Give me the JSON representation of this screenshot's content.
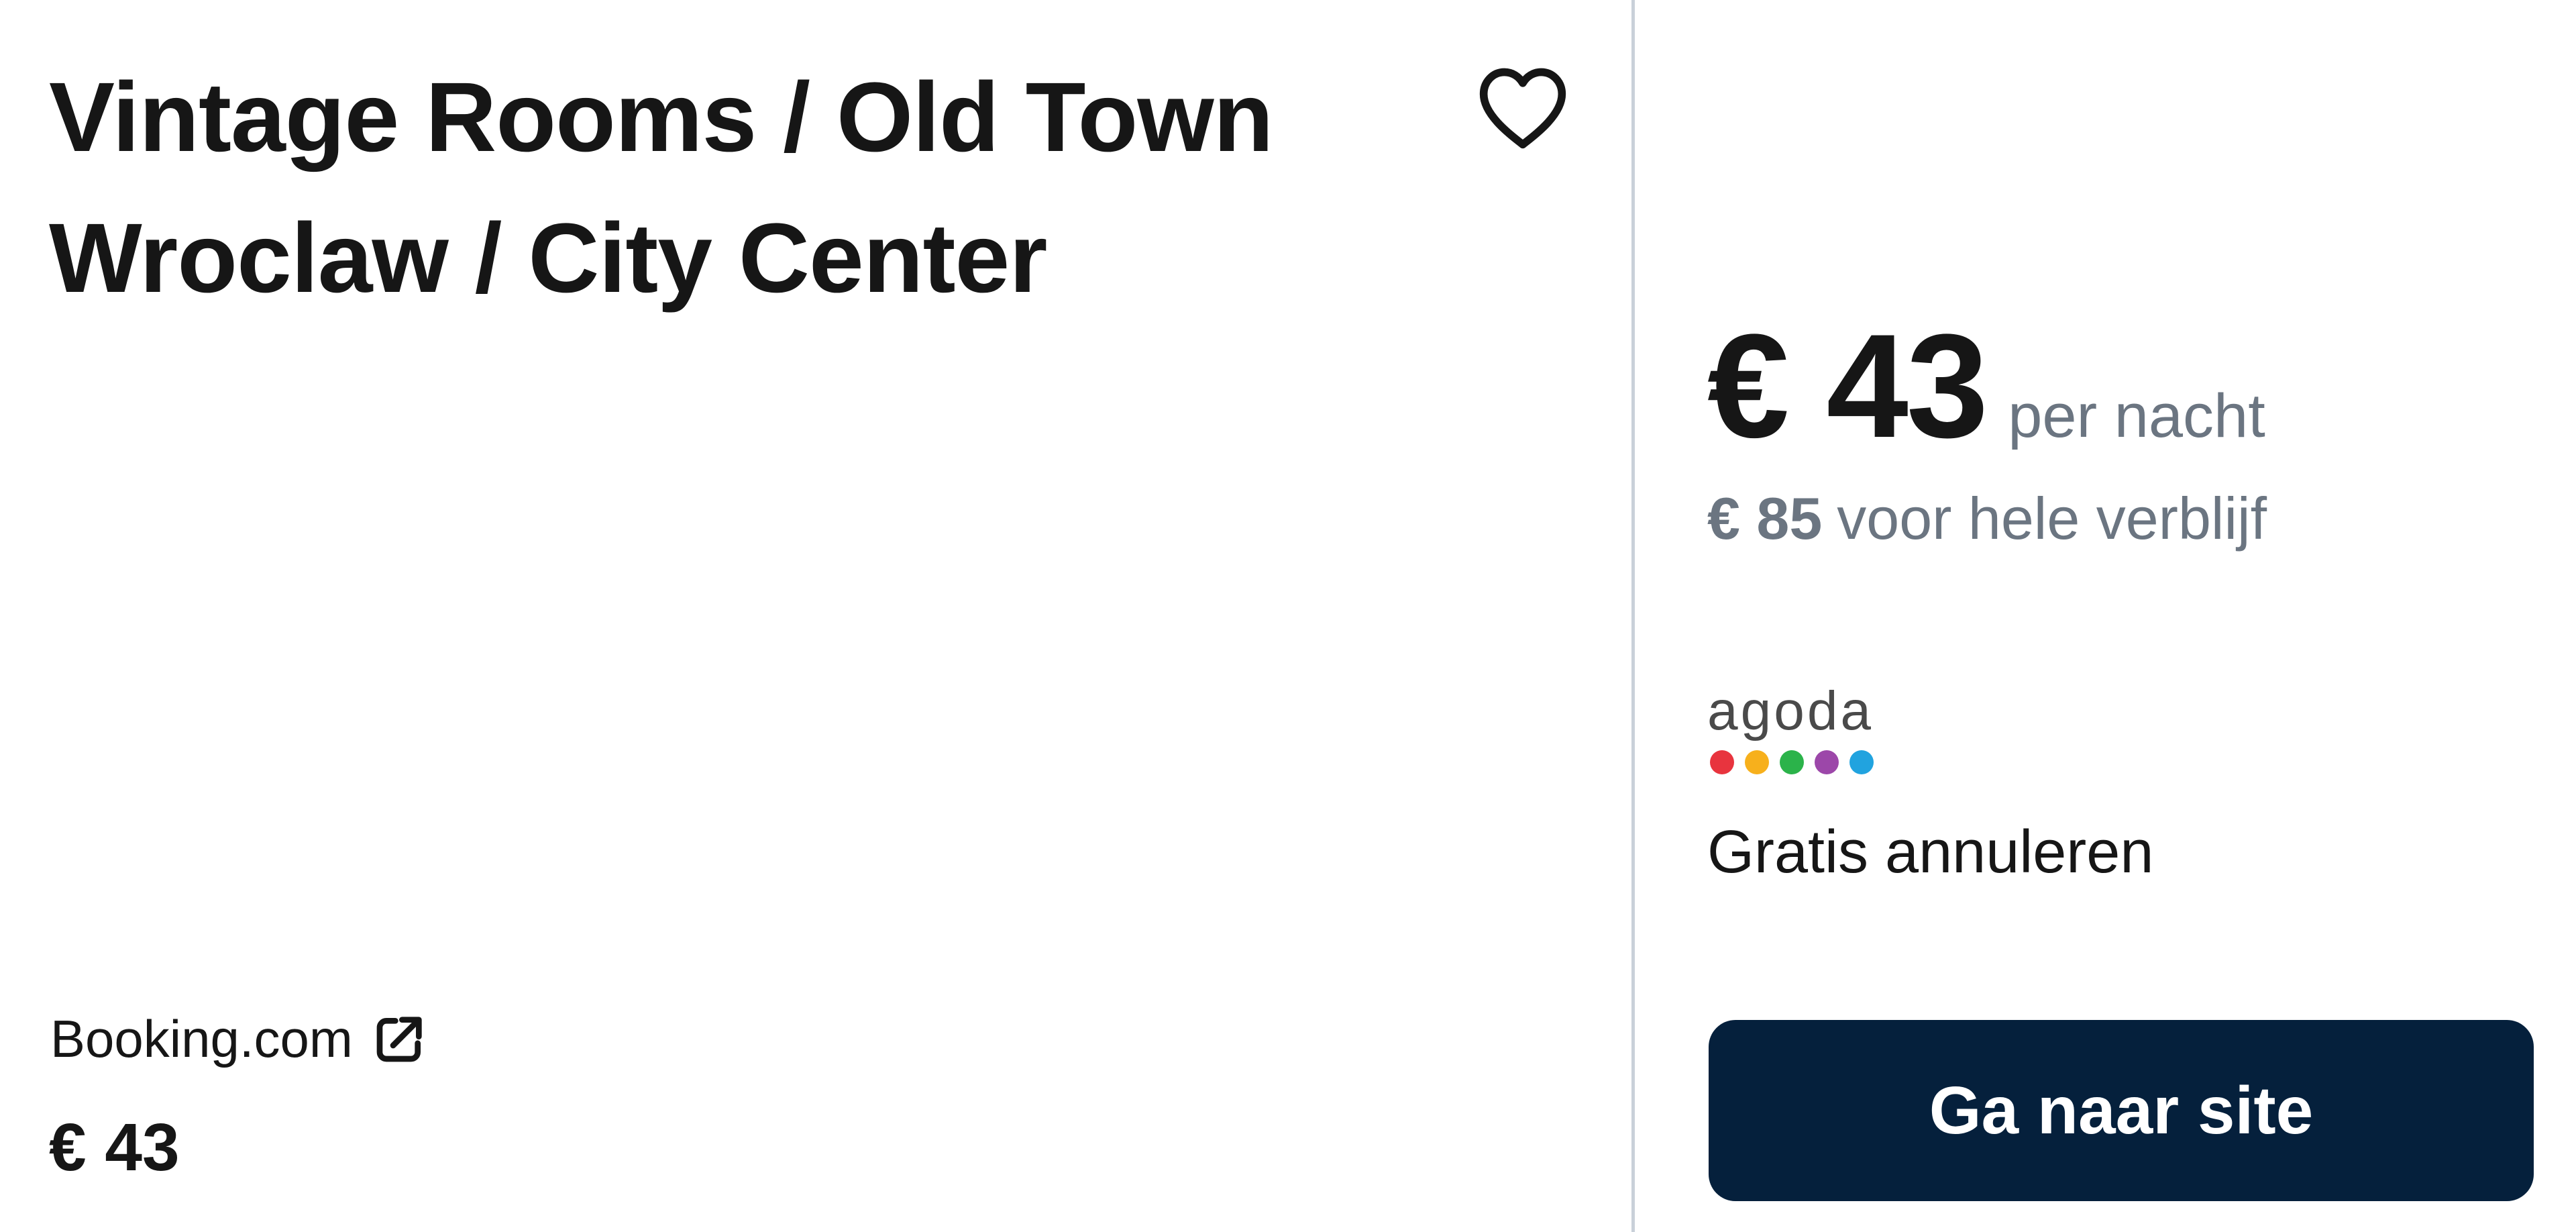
{
  "hotel": {
    "title_line1": "Vintage Rooms / Old Town",
    "title_line2": "Wroclaw / City Center"
  },
  "favorite": {
    "icon": "heart-outline-icon"
  },
  "left_offer": {
    "provider": "Booking.com",
    "provider_icon": "external-link-icon",
    "price": "€ 43"
  },
  "right_offer": {
    "nightly_price": "€ 43",
    "per_night_label": "per nacht",
    "total_price": "€ 85",
    "total_label": "voor hele verblijf",
    "provider_logo": {
      "text": "agoda",
      "dot_colors": [
        "#e8343e",
        "#f7b01c",
        "#2bb34a",
        "#9c47a9",
        "#21a3df"
      ]
    },
    "cancellation": "Gratis annuleren",
    "cta_label": "Ga naar site"
  },
  "colors": {
    "text": "#161616",
    "muted_text": "#6b7581",
    "button_bg": "#05203c",
    "button_text": "#ffffff",
    "divider": "#c9d0d9"
  }
}
